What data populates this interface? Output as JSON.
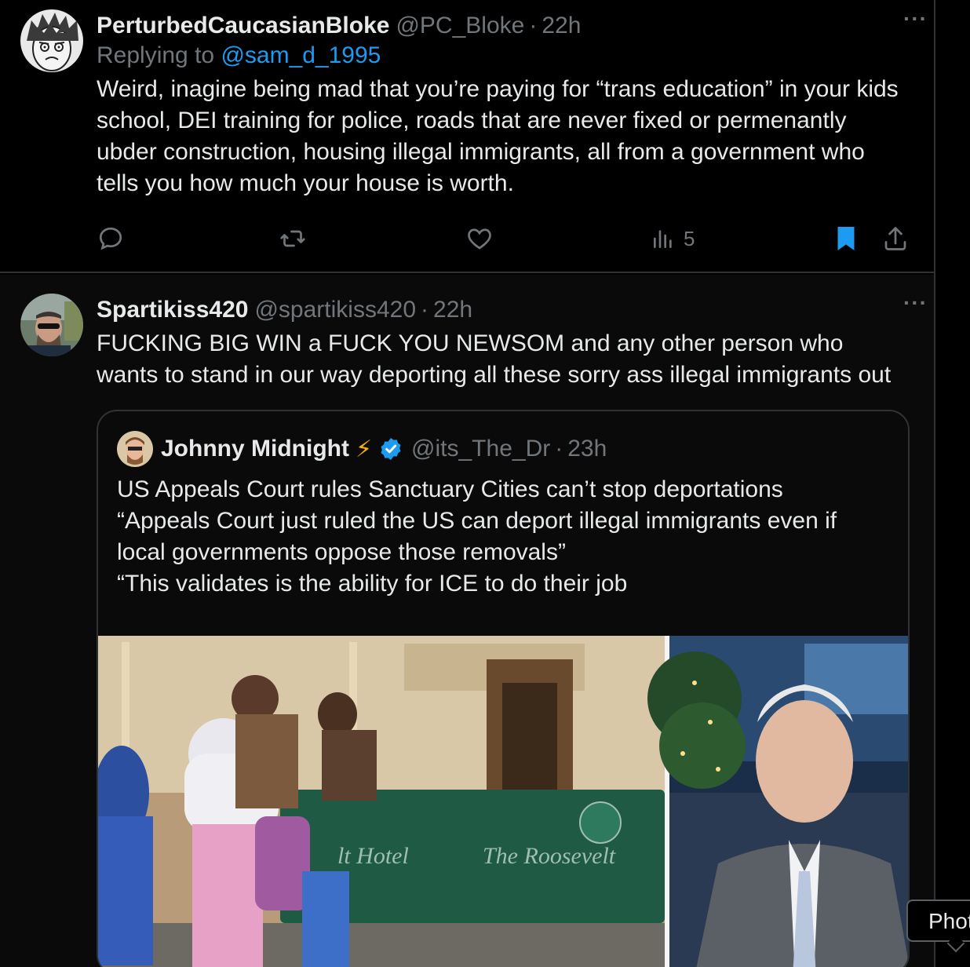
{
  "tweet1": {
    "display_name": "PerturbedCaucasianBloke",
    "handle": "@PC_Bloke",
    "separator": "·",
    "time": "22h",
    "more": "···",
    "replying_prefix": "Replying to",
    "replying_to": "@sam_d_1995",
    "text": "Weird, inagine being mad that you’re paying for “trans education” in your kids school, DEI training for police, roads that are never fixed or permenantly ubder construction, housing illegal immigrants, all from a government who tells you how much your house is worth.",
    "views": "5",
    "bookmark_color": "#1d9bf0"
  },
  "tweet2": {
    "display_name": "Spartikiss420",
    "handle": "@spartikiss420",
    "separator": "·",
    "time": "22h",
    "more": "···",
    "text": "FUCKING BIG WIN a FUCK YOU NEWSOM and any other person who wants to stand in our way deporting all these sorry ass illegal immigrants out"
  },
  "quote": {
    "display_name": "Johnny Midnight",
    "emoji": "⚡",
    "verified_color": "#1d9bf0",
    "handle": "@its_The_Dr",
    "separator": "·",
    "time": "23h",
    "text": "US Appeals Court rules Sanctuary Cities can’t stop deportations\n“Appeals Court just ruled the US can deport illegal immigrants even if local governments oppose those removals”\n“This validates is the ability for ICE to do their job",
    "media_sign_left": "lt Hotel",
    "media_sign_right": "The Roosevelt"
  },
  "tooltip": {
    "label": "Phot"
  }
}
